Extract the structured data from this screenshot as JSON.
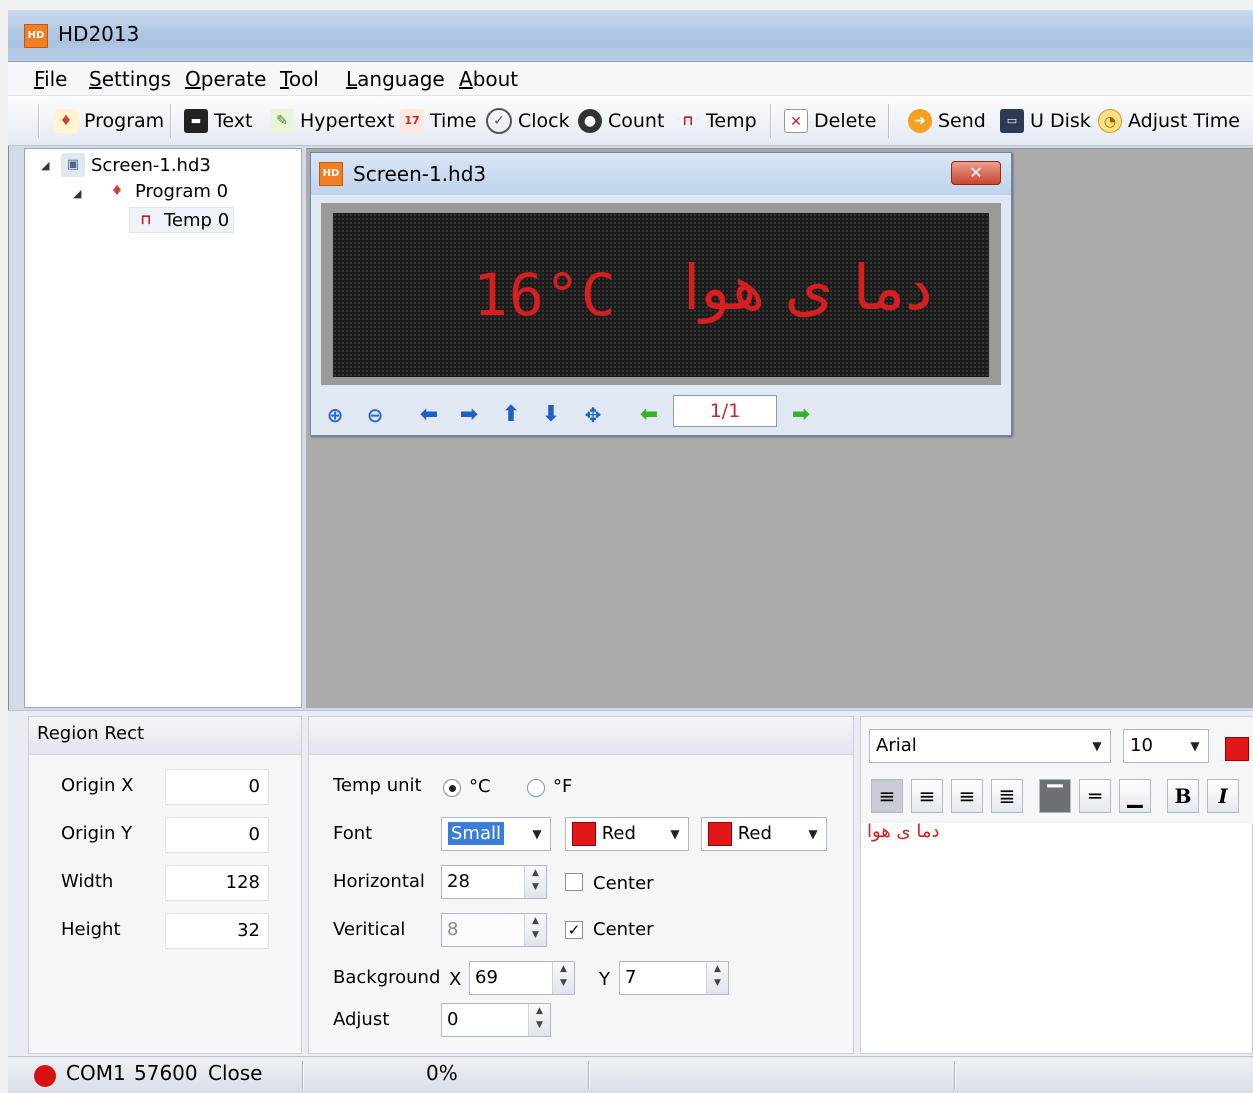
{
  "app": {
    "title": "HD2013"
  },
  "menu": {
    "file": "File",
    "settings": "Settings",
    "operate": "Operate",
    "tool": "Tool",
    "language": "Language",
    "about": "About"
  },
  "toolbar": {
    "program": "Program",
    "text": "Text",
    "hypertext": "Hypertext",
    "time": "Time",
    "clock": "Clock",
    "count": "Count",
    "temp": "Temp",
    "delete": "Delete",
    "send": "Send",
    "udisk": "U Disk",
    "adjust_time": "Adjust Time"
  },
  "tree": {
    "screen": "Screen-1.hd3",
    "program": "Program 0",
    "temp": "Temp 0"
  },
  "child_window": {
    "title": "Screen-1.hd3",
    "led_temp": "16°C",
    "led_label": "دما ی هوا",
    "page": "1/1"
  },
  "region_rect": {
    "header": "Region Rect",
    "origin_x_label": "Origin X",
    "origin_x": "0",
    "origin_y_label": "Origin Y",
    "origin_y": "0",
    "width_label": "Width",
    "width": "128",
    "height_label": "Height",
    "height": "32"
  },
  "temp_props": {
    "temp_unit_label": "Temp unit",
    "unit_c": "°C",
    "unit_f": "°F",
    "selected_unit": "°C",
    "font_label": "Font",
    "font_value": "Small",
    "color1": "Red",
    "color2": "Red",
    "horizontal_label": "Horizontal",
    "horizontal": "28",
    "horizontal_center": "Center",
    "vertical_label": "Veritical",
    "vertical": "8",
    "vertical_center": "Center",
    "background_label": "Background",
    "bg_x_label": "X",
    "bg_x": "69",
    "bg_y_label": "Y",
    "bg_y": "7",
    "adjust_label": "Adjust",
    "adjust": "0",
    "accent_color": "#e01818"
  },
  "text_editor": {
    "font_family": "Arial",
    "font_size": "10",
    "bold": "B",
    "italic": "I",
    "content": "دما ی هوا"
  },
  "status": {
    "port": "COM1",
    "baud": "57600",
    "state": "Close",
    "progress": "0%"
  }
}
